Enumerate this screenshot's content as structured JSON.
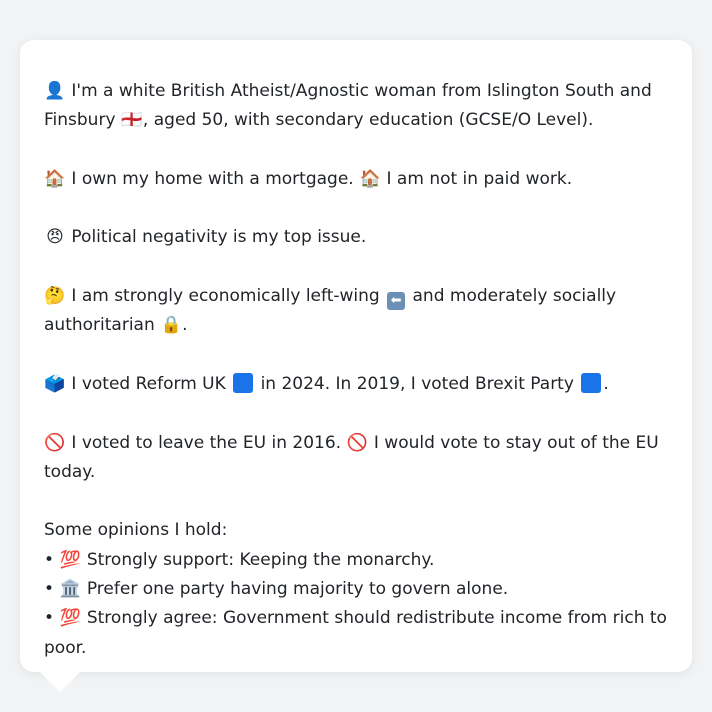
{
  "profile": {
    "intro": {
      "icon": "👤",
      "text_a": "I'm a white British Atheist/Agnostic woman from Islington South and Finsbury",
      "flag": "🏴󠁧󠁢󠁥󠁮󠁧󠁿",
      "text_b": ", aged 50, with secondary education (GCSE/O Level)."
    },
    "housing": {
      "icon_1": "🏠",
      "text_1": "I own my home with a mortgage.",
      "icon_2": "🏠",
      "text_2": "I am not in paid work."
    },
    "issue": {
      "icon": "😠",
      "text": "Political negativity is my top issue."
    },
    "ideology": {
      "icon": "🤔",
      "text_a": "I am strongly economically left-wing",
      "arrow": "⬅",
      "text_b": "and moderately socially authoritarian",
      "lock": "🔒",
      "text_c": "."
    },
    "votes": {
      "icon": "🗳️",
      "text_a": "I voted Reform UK",
      "text_b": "in 2024. In 2019, I voted Brexit Party",
      "text_c": ".",
      "party_color_2024": "#1a73e8",
      "party_color_2019": "#1a73e8"
    },
    "eu": {
      "icon_1": "🚫",
      "text_1": "I voted to leave the EU in 2016.",
      "icon_2": "🚫",
      "text_2": "I would vote to stay out of the EU today."
    },
    "opinions": {
      "heading": "Some opinions I hold:",
      "items": [
        {
          "bullet": "•",
          "icon": "💯",
          "text": "Strongly support: Keeping the monarchy."
        },
        {
          "bullet": "•",
          "icon": "🏛️",
          "text": "Prefer one party having majority to govern alone."
        },
        {
          "bullet": "•",
          "icon": "💯",
          "text": "Strongly agree: Government should redistribute income from rich to poor."
        }
      ]
    }
  },
  "colors": {
    "background": "#f1f3f5",
    "card": "#ffffff",
    "text": "#212529"
  }
}
